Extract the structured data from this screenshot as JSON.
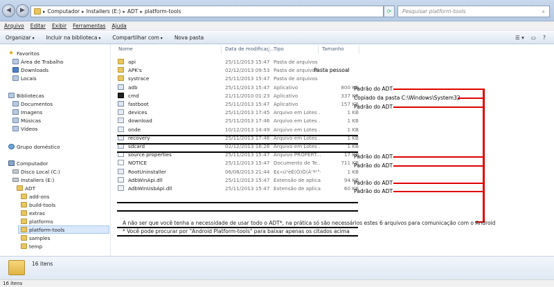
{
  "address": {
    "segments": [
      "Computador",
      "Installers (E:)",
      "ADT",
      "platform-tools"
    ]
  },
  "search": {
    "placeholder": "Pesquisar platform-tools"
  },
  "menu": [
    "Arquivo",
    "Editar",
    "Exibir",
    "Ferramentas",
    "Ajuda"
  ],
  "toolbar": {
    "organize": "Organizar",
    "include": "Incluir na biblioteca",
    "share": "Compartilhar com",
    "new_folder": "Nova pasta"
  },
  "nav": {
    "favorites": "Favoritos",
    "desktop": "Área de Trabalho",
    "downloads": "Downloads",
    "places": "Locais",
    "libraries": "Bibliotecas",
    "documents": "Documentos",
    "images": "Imagens",
    "music": "Músicas",
    "videos": "Vídeos",
    "homegroup": "Grupo doméstico",
    "computer": "Computador",
    "local_disk": "Disco Local (C:)",
    "installers": "Installers (E:)",
    "adt": "ADT",
    "children": [
      "add-ons",
      "build-tools",
      "extras",
      "platforms",
      "platform-tools",
      "samples",
      "temp"
    ]
  },
  "columns": {
    "name": "Nome",
    "date": "Data de modificaç...",
    "type": "Tipo",
    "size": "Tamanho"
  },
  "files": [
    {
      "name": "api",
      "date": "25/11/2013 15:47",
      "type": "Pasta de arquivos",
      "size": "",
      "icon": "folder"
    },
    {
      "name": "APK's",
      "date": "02/12/2013 09:53",
      "type": "Pasta de arquivos",
      "size": "",
      "icon": "folder"
    },
    {
      "name": "systrace",
      "date": "25/11/2013 15:47",
      "type": "Pasta de arquivos",
      "size": "",
      "icon": "folder"
    },
    {
      "name": "adb",
      "date": "25/11/2013 15:47",
      "type": "Aplicativo",
      "size": "800 KB",
      "icon": "exe"
    },
    {
      "name": "cmd",
      "date": "21/11/2010 01:23",
      "type": "Aplicativo",
      "size": "337 KB",
      "icon": "cmd"
    },
    {
      "name": "fastboot",
      "date": "25/11/2013 15:47",
      "type": "Aplicativo",
      "size": "157 KB",
      "icon": "exe"
    },
    {
      "name": "devices",
      "date": "25/11/2013 17:45",
      "type": "Arquivo em Lotes ...",
      "size": "1 KB",
      "icon": "bat"
    },
    {
      "name": "download",
      "date": "25/11/2013 17:46",
      "type": "Arquivo em Lotes ...",
      "size": "1 KB",
      "icon": "bat"
    },
    {
      "name": "onde",
      "date": "10/12/2013 14:49",
      "type": "Arquivo em Lotes ...",
      "size": "1 KB",
      "icon": "bat"
    },
    {
      "name": "recovery",
      "date": "25/11/2013 17:46",
      "type": "Arquivo em Lotes ...",
      "size": "1 KB",
      "icon": "bat"
    },
    {
      "name": "sdcard",
      "date": "02/12/2013 16:26",
      "type": "Arquivo em Lotes ...",
      "size": "1 KB",
      "icon": "bat"
    },
    {
      "name": "source.properties",
      "date": "25/11/2013 15:47",
      "type": "Arquivo PROPERT...",
      "size": "17 KB",
      "icon": "doc"
    },
    {
      "name": "NOTICE",
      "date": "25/11/2013 15:47",
      "type": "Documento de Te...",
      "size": "711 KB",
      "icon": "doc"
    },
    {
      "name": "RootUninstaller",
      "date": "06/08/2013 21:44",
      "type": "Ε¢«ú¹èÉ(Ò)Ò(À‘ª¹°‹",
      "size": "1 KB",
      "icon": "bat"
    },
    {
      "name": "AdbWinApi.dll",
      "date": "25/11/2013 15:47",
      "type": "Extensão de aplica...",
      "size": "94 KB",
      "icon": "dll"
    },
    {
      "name": "AdbWinUsbApi.dll",
      "date": "25/11/2013 15:47",
      "type": "Extensão de aplica...",
      "size": "60 KB",
      "icon": "dll"
    }
  ],
  "annotations": {
    "personal_folder": "Pasta pessoal",
    "adt_default": "Padrão do ADT",
    "copied_from": "Copiado da pasta C:\\Windows\\System32",
    "note1": "A não ser que você tenha a necessidade de usar todo o ADT*, na prática só são necessários estes 6 arquivos para comunicação com o Android",
    "note2": "* Você pode procurar por \"Android Platform-tools\" para baixar apenas os citados acima"
  },
  "details": {
    "count": "16 itens"
  },
  "status": {
    "count": "16 itens"
  },
  "colors": {
    "annotation_line": "#e00000",
    "selection": "#d9e8fa"
  }
}
